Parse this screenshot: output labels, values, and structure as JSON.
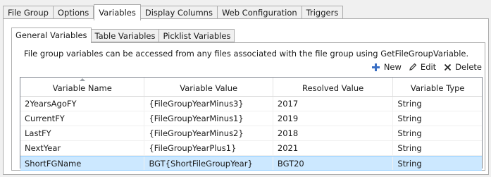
{
  "outer_tabs": [
    "File Group",
    "Options",
    "Variables",
    "Display Columns",
    "Web Configuration",
    "Triggers"
  ],
  "inner_tabs": [
    "General Variables",
    "Table Variables",
    "Picklist Variables"
  ],
  "description": "File group variables can be accessed from any files associated with the file group using GetFileGroupVariable.",
  "toolbar": {
    "new_label": "New",
    "edit_label": "Edit",
    "delete_label": "Delete",
    "new_icon": "plus-icon",
    "edit_icon": "pencil-icon",
    "delete_icon": "x-icon",
    "new_icon_color": "#3a6fc4"
  },
  "table": {
    "columns": [
      "Variable Name",
      "Variable Value",
      "Resolved Value",
      "Variable Type"
    ],
    "sorted_column": "Variable Name",
    "rows": [
      [
        "2YearsAgoFY",
        "{FileGroupYearMinus3}",
        "2017",
        "String"
      ],
      [
        "CurrentFY",
        "{FileGroupYearMinus1}",
        "2019",
        "String"
      ],
      [
        "LastFY",
        "{FileGroupYearMinus2}",
        "2018",
        "String"
      ],
      [
        "NextYear",
        "{FileGroupYearPlus1}",
        "2021",
        "String"
      ],
      [
        "ShortFGName",
        "BGT{ShortFileGroupYear}",
        "BGT20",
        "String"
      ]
    ],
    "selected_row": 4
  }
}
